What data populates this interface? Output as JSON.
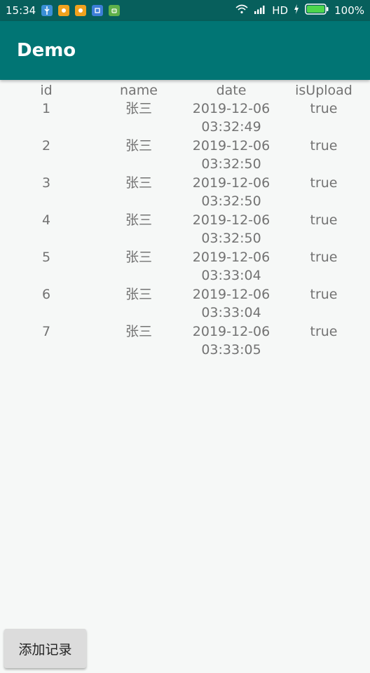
{
  "status_bar": {
    "time": "15:34",
    "network": "HD",
    "battery": "100%",
    "notification_icons": [
      "usb-icon",
      "app-icon-1",
      "app-icon-2",
      "app-icon-3",
      "android-icon"
    ],
    "bg_color": "#075f5c"
  },
  "app_bar": {
    "title": "Demo",
    "bg_color": "#017574"
  },
  "table": {
    "headers": [
      "id",
      "name",
      "date",
      "isUpload"
    ],
    "rows": [
      {
        "id": "1",
        "name": "张三",
        "date_line1": "2019-12-06",
        "date_line2": "03:32:49",
        "is_upload": "true"
      },
      {
        "id": "2",
        "name": "张三",
        "date_line1": "2019-12-06",
        "date_line2": "03:32:50",
        "is_upload": "true"
      },
      {
        "id": "3",
        "name": "张三",
        "date_line1": "2019-12-06",
        "date_line2": "03:32:50",
        "is_upload": "true"
      },
      {
        "id": "4",
        "name": "张三",
        "date_line1": "2019-12-06",
        "date_line2": "03:32:50",
        "is_upload": "true"
      },
      {
        "id": "5",
        "name": "张三",
        "date_line1": "2019-12-06",
        "date_line2": "03:33:04",
        "is_upload": "true"
      },
      {
        "id": "6",
        "name": "张三",
        "date_line1": "2019-12-06",
        "date_line2": "03:33:04",
        "is_upload": "true"
      },
      {
        "id": "7",
        "name": "张三",
        "date_line1": "2019-12-06",
        "date_line2": "03:33:05",
        "is_upload": "true"
      }
    ]
  },
  "add_button": {
    "label": "添加记录"
  }
}
